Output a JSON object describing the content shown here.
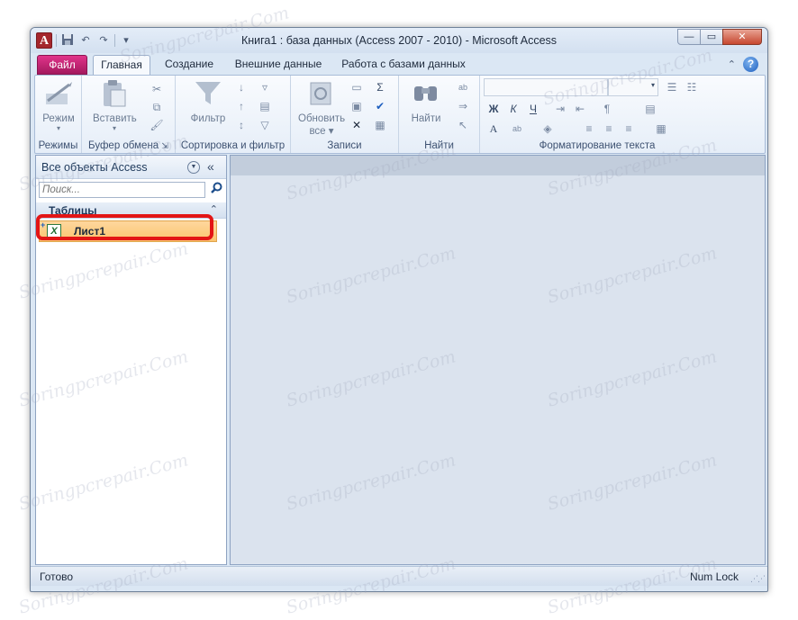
{
  "window": {
    "title": "Книга1 : база данных (Access 2007 - 2010)  -  Microsoft Access",
    "app_icon": "A",
    "controls": {
      "minimize": "—",
      "maximize": "▭",
      "close": "✕"
    }
  },
  "qat": {
    "save": "save-icon",
    "undo": "↶",
    "redo": "↷",
    "customize": "▾"
  },
  "tabs": [
    {
      "label": "Файл"
    },
    {
      "label": "Главная"
    },
    {
      "label": "Создание"
    },
    {
      "label": "Внешние данные"
    },
    {
      "label": "Работа с базами данных"
    }
  ],
  "ribbon": {
    "groups": {
      "views": "Режимы",
      "clipboard": "Буфер обмена",
      "sort": "Сортировка и фильтр",
      "records": "Записи",
      "find": "Найти",
      "text": "Форматирование текста"
    },
    "buttons": {
      "view": "Режим",
      "paste": "Вставить",
      "filter": "Фильтр",
      "refresh_line1": "Обновить",
      "refresh_line2": "все",
      "find": "Найти"
    },
    "format": {
      "bold": "Ж",
      "italic": "К",
      "underline": "Ч",
      "font_color": "A",
      "highlight": "ab",
      "sigma": "Σ"
    },
    "dialog_launcher": "⇲"
  },
  "nav": {
    "title": "Все объекты Access",
    "search_placeholder": "Поиск...",
    "section": "Таблицы",
    "items": [
      {
        "label": "Лист1",
        "icon": "X"
      }
    ]
  },
  "status": {
    "left": "Готово",
    "right": "Num Lock"
  },
  "watermark": "Soringpcrepair.Com"
}
